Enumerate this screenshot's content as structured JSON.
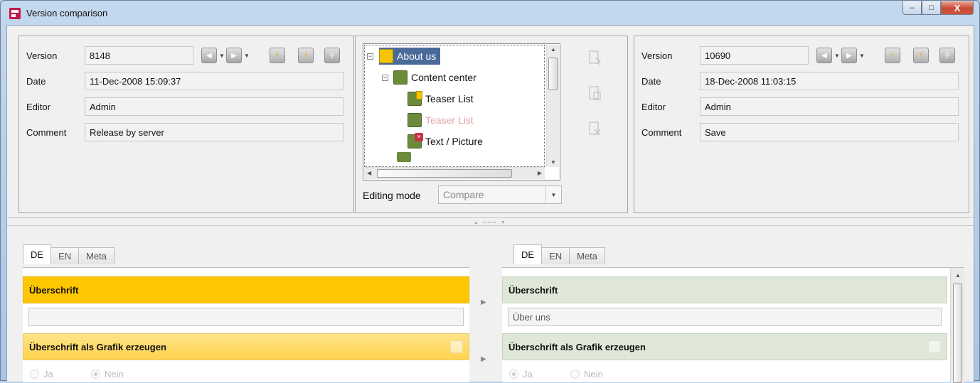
{
  "window": {
    "title": "Version comparison",
    "buttons": {
      "minimize": "–",
      "maximize": "□",
      "close": "X"
    }
  },
  "left": {
    "labels": {
      "version": "Version",
      "date": "Date",
      "editor": "Editor",
      "comment": "Comment"
    },
    "version": "8148",
    "date": "11-Dec-2008 15:09:37",
    "editor": "Admin",
    "comment": "Release by server"
  },
  "right": {
    "labels": {
      "version": "Version",
      "date": "Date",
      "editor": "Editor",
      "comment": "Comment"
    },
    "version": "10690",
    "date": "18-Dec-2008 11:03:15",
    "editor": "Admin",
    "comment": "Save"
  },
  "tree": {
    "nodes": [
      {
        "label": "About us",
        "selected": true
      },
      {
        "label": "Content center"
      },
      {
        "label": "Teaser List"
      },
      {
        "label": "Teaser List",
        "faded": true
      },
      {
        "label": "Text / Picture"
      }
    ],
    "editing_mode_label": "Editing mode",
    "editing_mode_value": "Compare"
  },
  "tabs_left": [
    "DE",
    "EN",
    "Meta"
  ],
  "tabs_right": [
    "DE",
    "EN",
    "Meta"
  ],
  "editor_left": {
    "sections": [
      {
        "title": "Überschrift",
        "value": ""
      },
      {
        "title": "Überschrift als Grafik erzeugen",
        "options": [
          "Ja",
          "Nein"
        ],
        "selected": "Nein"
      }
    ]
  },
  "editor_right": {
    "sections": [
      {
        "title": "Überschrift",
        "value": "Über uns"
      },
      {
        "title": "Überschrift als Grafik erzeugen",
        "options": [
          "Ja",
          "Nein"
        ],
        "selected": "Ja"
      }
    ]
  },
  "colors": {
    "changed": "#ffc700",
    "unchanged": "#dfe8d8",
    "selection": "#4a6a9a"
  },
  "icons": {
    "nav": [
      "previous-version-icon",
      "next-version-icon",
      "release-icon",
      "release-next-icon",
      "search-icon"
    ],
    "side": [
      "copy-to-right-icon",
      "copy-page-icon",
      "delete-compare-icon"
    ]
  }
}
